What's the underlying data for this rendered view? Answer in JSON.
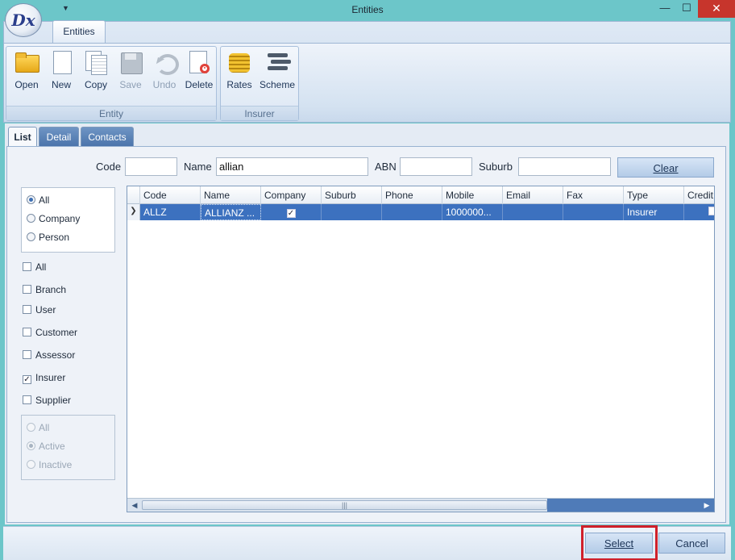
{
  "window": {
    "title": "Entities",
    "app_logo_text": "Dx"
  },
  "ribbon": {
    "tab": "Entities",
    "groups": {
      "entity": {
        "caption": "Entity",
        "buttons": [
          {
            "label": "Open",
            "icon": "folder-open-icon",
            "enabled": true
          },
          {
            "label": "New",
            "icon": "new-page-icon",
            "enabled": true
          },
          {
            "label": "Copy",
            "icon": "copy-icon",
            "enabled": true
          },
          {
            "label": "Save",
            "icon": "save-icon",
            "enabled": false
          },
          {
            "label": "Undo",
            "icon": "undo-icon",
            "enabled": false
          },
          {
            "label": "Delete",
            "icon": "delete-icon",
            "enabled": true
          }
        ]
      },
      "insurer": {
        "caption": "Insurer",
        "buttons": [
          {
            "label": "Rates",
            "icon": "coins-icon",
            "enabled": true
          },
          {
            "label": "Scheme",
            "icon": "scheme-icon",
            "enabled": true
          }
        ]
      }
    }
  },
  "tabs": [
    "List",
    "Detail",
    "Contacts"
  ],
  "search": {
    "code_label": "Code",
    "code_value": "",
    "name_label": "Name",
    "name_value": "allian",
    "abn_label": "ABN",
    "abn_value": "",
    "suburb_label": "Suburb",
    "suburb_value": "",
    "clear_label": "Clear"
  },
  "entity_kind": {
    "options": [
      "All",
      "Company",
      "Person"
    ],
    "selected": "All"
  },
  "roles": [
    {
      "label": "All",
      "checked": false
    },
    {
      "label": "Branch",
      "checked": false
    },
    {
      "label": "User",
      "checked": false
    },
    {
      "label": "Customer",
      "checked": false
    },
    {
      "label": "Assessor",
      "checked": false
    },
    {
      "label": "Insurer",
      "checked": true
    },
    {
      "label": "Supplier",
      "checked": false
    }
  ],
  "status": {
    "options": [
      "All",
      "Active",
      "Inactive"
    ],
    "selected": "Active",
    "enabled": false
  },
  "grid": {
    "columns": [
      "Code",
      "Name",
      "Company",
      "Suburb",
      "Phone",
      "Mobile",
      "Email",
      "Fax",
      "Type",
      "Credit"
    ],
    "rows": [
      {
        "code": "ALLZ",
        "name": "ALLIANZ ...",
        "company": true,
        "suburb": "",
        "phone": "",
        "mobile": "1000000...",
        "email": "",
        "fax": "",
        "type": "Insurer",
        "credit": ""
      }
    ]
  },
  "footer": {
    "select_label": "Select",
    "cancel_label": "Cancel"
  },
  "colors": {
    "titlebar": "#6cc6c9",
    "selection": "#3c71bf",
    "close": "#c7352c",
    "highlight": "#d0202a"
  }
}
